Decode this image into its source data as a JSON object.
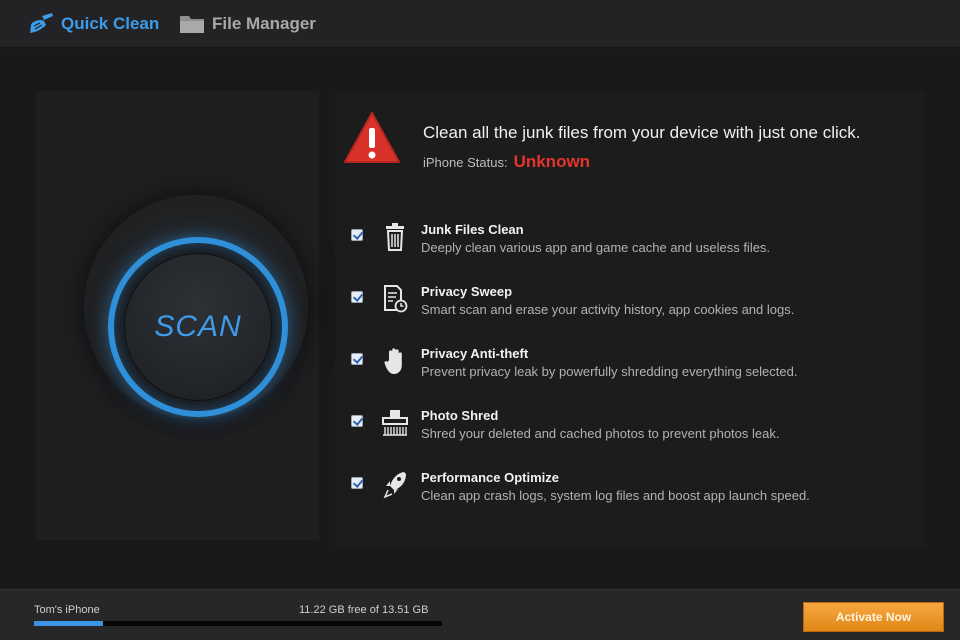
{
  "nav": {
    "quick_clean": "Quick Clean",
    "file_manager": "File Manager",
    "active_color": "#3d9be9",
    "inactive_color": "#a9a9ab"
  },
  "scan": {
    "label": "SCAN"
  },
  "header": {
    "headline": "Clean all the junk files from your device with just one click.",
    "status_label": "iPhone Status:",
    "status_value": "Unknown",
    "status_color": "#e5342b",
    "icon": "warning-icon"
  },
  "features": [
    {
      "title": "Junk Files Clean",
      "desc": "Deeply clean various app and game cache and useless files.",
      "checked": true,
      "icon": "trash-icon"
    },
    {
      "title": "Privacy Sweep",
      "desc": "Smart scan and erase your activity history, app cookies and logs.",
      "checked": true,
      "icon": "document-clock-icon"
    },
    {
      "title": "Privacy Anti-theft",
      "desc": "Prevent privacy leak by powerfully shredding everything selected.",
      "checked": true,
      "icon": "hand-icon"
    },
    {
      "title": "Photo Shred",
      "desc": "Shred your deleted and cached photos to prevent photos leak.",
      "checked": true,
      "icon": "shredder-icon"
    },
    {
      "title": "Performance Optimize",
      "desc": "Clean app crash logs, system log files and boost app launch speed.",
      "checked": true,
      "icon": "rocket-icon"
    }
  ],
  "footer": {
    "device_name": "Tom's iPhone",
    "storage_text": "11.22 GB free of 13.51 GB",
    "storage_free_gb": 11.22,
    "storage_total_gb": 13.51,
    "activate_label": "Activate Now",
    "activate_color": "#f0982c"
  }
}
